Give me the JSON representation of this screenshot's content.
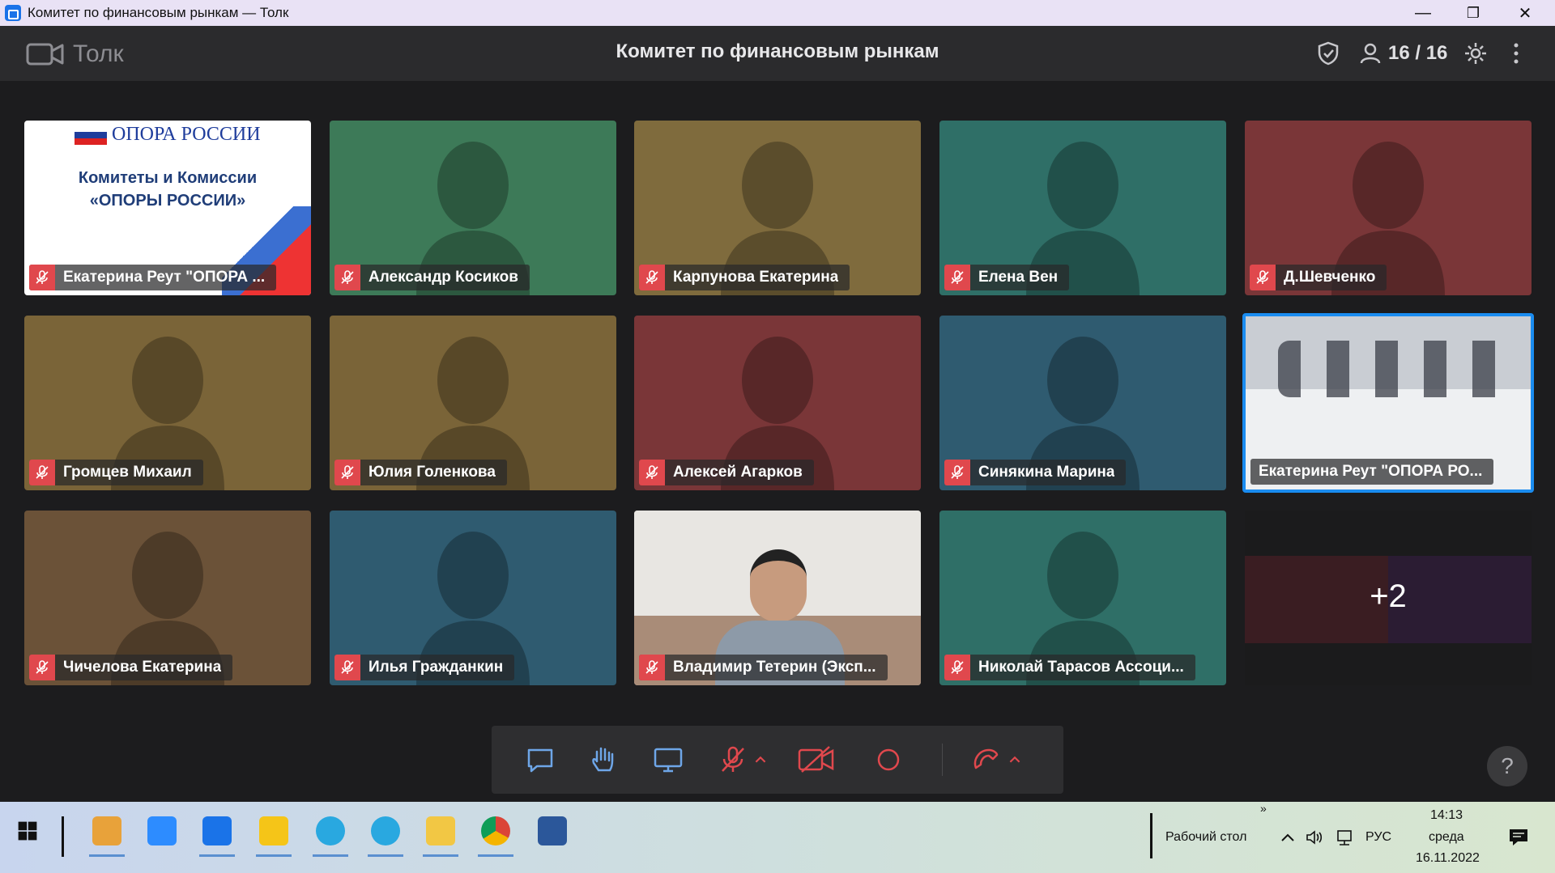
{
  "window": {
    "title": "Комитет по финансовым рынкам — Толк",
    "minimize": "—",
    "restore": "❐",
    "close": "✕"
  },
  "header": {
    "brand": "Толк",
    "conference_title": "Комитет по финансовым рынкам",
    "participants_count": "16 / 16",
    "icons": [
      "camera-icon",
      "shield-check-icon",
      "participants-icon",
      "gear-icon",
      "more-vertical-icon"
    ]
  },
  "participants": [
    {
      "name": "Екатерина Реут \"ОПОРА ...",
      "color": "#ffffff",
      "type": "slide"
    },
    {
      "name": "Александр Косиков",
      "color": "#3d7a58"
    },
    {
      "name": "Карпунова Екатерина",
      "color": "#7f6b3d"
    },
    {
      "name": "Елена Вен",
      "color": "#2f6f67"
    },
    {
      "name": "Д.Шевченко",
      "color": "#7a3638"
    },
    {
      "name": "Громцев Михаил",
      "color": "#7a6438"
    },
    {
      "name": "Юлия Голенкова",
      "color": "#7a6438"
    },
    {
      "name": "Алексей Агарков",
      "color": "#7a3638"
    },
    {
      "name": "Синякина Марина",
      "color": "#2f5b70"
    },
    {
      "name": "Екатерина Реут \"ОПОРА РО...",
      "color": "#dfe3e8",
      "type": "video-room"
    },
    {
      "name": "Чичелова Екатерина",
      "color": "#6b5238"
    },
    {
      "name": "Илья Гражданкин",
      "color": "#2f5b70"
    },
    {
      "name": "Владимир Тетерин (Эксп...",
      "color": "#cfc8bd",
      "type": "video-person"
    },
    {
      "name": "Николай Тарасов Ассоци...",
      "color": "#2f6f67"
    }
  ],
  "slide": {
    "org": "ОПОРА РОССИИ",
    "line1": "Комитеты и Комиссии",
    "line2": "«ОПОРЫ РОССИИ»"
  },
  "more_tile": {
    "label": "+2"
  },
  "toolbar": {
    "icons": [
      "chat-icon",
      "raise-hand-icon",
      "screen-share-icon",
      "mic-muted-icon",
      "chevron-up-icon",
      "camera-off-icon",
      "record-icon",
      "hangup-icon",
      "chevron-up-icon"
    ]
  },
  "help": {
    "label": "?"
  },
  "taskbar": {
    "apps": [
      {
        "name": "outlook-icon",
        "color": "#e8a23a"
      },
      {
        "name": "zoom-icon",
        "color": "#2d8cff"
      },
      {
        "name": "tolk-icon",
        "color": "#1a73e8"
      },
      {
        "name": "1c-icon",
        "color": "#f5c518"
      },
      {
        "name": "bitrix24-icon",
        "color": "#29a8e0"
      },
      {
        "name": "bitrix24-2-icon",
        "color": "#29a8e0"
      },
      {
        "name": "explorer-icon",
        "color": "#f2c744"
      },
      {
        "name": "chrome-icon",
        "color": "#db4437"
      },
      {
        "name": "word-icon",
        "color": "#2b579a"
      }
    ],
    "desktop_label": "Рабочий стол",
    "chevron": "»",
    "lang": "РУС",
    "time": "14:13",
    "weekday": "среда",
    "date": "16.11.2022"
  }
}
